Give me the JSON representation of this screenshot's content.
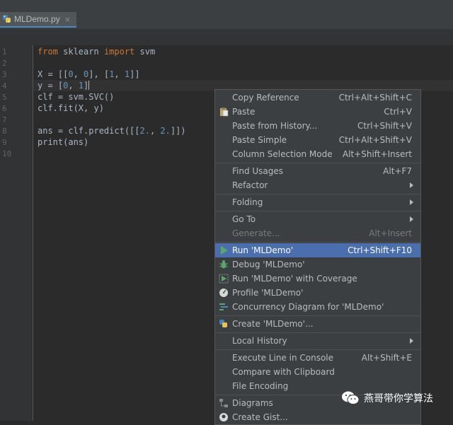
{
  "tab": {
    "filename": "MLDemo.py",
    "close": "×"
  },
  "gutter": {
    "lines": [
      "1",
      "2",
      "3",
      "4",
      "5",
      "6",
      "7",
      "8",
      "9",
      "10"
    ]
  },
  "code": {
    "l1": {
      "k1": "from",
      "t1": " sklearn ",
      "k2": "import",
      "t2": " svm"
    },
    "l3": {
      "a": "X = [[",
      "n1": "0",
      "b": ", ",
      "n2": "0",
      "c": "], [",
      "n3": "1",
      "d": ", ",
      "n4": "1",
      "e": "]]"
    },
    "l4": {
      "a": "y = [",
      "n1": "0",
      "b": ", ",
      "n2": "1",
      "c": "]"
    },
    "l5": "clf = svm.SVC()",
    "l6": "clf.fit(X, y)",
    "l8": {
      "a": "ans = clf.predict([[",
      "n1": "2.",
      "b": ", ",
      "n2": "2.",
      "c": "]])"
    },
    "l9": "print(ans)"
  },
  "menu": {
    "copy_reference": {
      "label": "Copy Reference",
      "shortcut": "Ctrl+Alt+Shift+C"
    },
    "paste": {
      "label": "Paste",
      "shortcut": "Ctrl+V"
    },
    "paste_history": {
      "label": "Paste from History...",
      "shortcut": "Ctrl+Shift+V"
    },
    "paste_simple": {
      "label": "Paste Simple",
      "shortcut": "Ctrl+Alt+Shift+V"
    },
    "column_selection": {
      "label": "Column Selection Mode",
      "shortcut": "Alt+Shift+Insert"
    },
    "find_usages": {
      "label": "Find Usages",
      "shortcut": "Alt+F7"
    },
    "refactor": {
      "label": "Refactor"
    },
    "folding": {
      "label": "Folding"
    },
    "go_to": {
      "label": "Go To"
    },
    "generate": {
      "label": "Generate...",
      "shortcut": "Alt+Insert"
    },
    "run": {
      "label": "Run 'MLDemo'",
      "shortcut": "Ctrl+Shift+F10"
    },
    "debug": {
      "label": "Debug 'MLDemo'"
    },
    "coverage": {
      "label": "Run 'MLDemo' with Coverage"
    },
    "profile": {
      "label": "Profile 'MLDemo'"
    },
    "concurrency": {
      "label": "Concurrency Diagram for  'MLDemo'"
    },
    "create": {
      "label": "Create 'MLDemo'..."
    },
    "local_history": {
      "label": "Local History"
    },
    "execute_line": {
      "label": "Execute Line in Console",
      "shortcut": "Alt+Shift+E"
    },
    "compare_clipboard": {
      "label": "Compare with Clipboard"
    },
    "file_encoding": {
      "label": "File Encoding"
    },
    "diagrams": {
      "label": "Diagrams"
    },
    "create_gist": {
      "label": "Create Gist..."
    }
  },
  "watermark": {
    "text": "燕哥带你学算法"
  },
  "colors": {
    "background": "#2b2b2b",
    "keyword": "#cc7832",
    "number": "#6897bb",
    "text": "#a9b7c6",
    "menu_background": "#3c3f41",
    "menu_selection": "#4b6eaf",
    "run_icon": "#59a869"
  }
}
